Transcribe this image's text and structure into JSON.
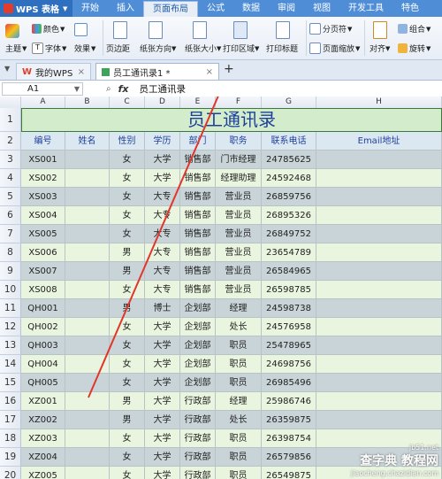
{
  "menubar": {
    "app_title": "WPS 表格",
    "items": [
      "开始",
      "插入",
      "页面布局",
      "公式",
      "数据",
      "审阅",
      "视图",
      "开发工具",
      "特色"
    ],
    "active_index": 2
  },
  "ribbon": {
    "theme": "主题",
    "colors": "颜色",
    "fonts": "字体",
    "effects": "效果",
    "margins": "页边距",
    "orientation": "纸张方向",
    "size": "纸张大小",
    "print_area": "打印区域",
    "print_titles": "打印标题",
    "page_break": "分页符",
    "page_zoom": "页面缩放",
    "align": "对齐",
    "group": "组合",
    "rotate": "旋转"
  },
  "tabs": {
    "tab1_label": "我的WPS",
    "tab2_label": "员工通讯录1 *",
    "add": "+"
  },
  "formula_bar": {
    "cell_ref": "A1",
    "fx": "fx",
    "value": "员工通讯录"
  },
  "sheet": {
    "columns": [
      "A",
      "B",
      "C",
      "D",
      "E",
      "F",
      "G",
      "H"
    ],
    "title": "员工通讯录",
    "headers": [
      "编号",
      "姓名",
      "性别",
      "学历",
      "部门",
      "职务",
      "联系电话",
      "Email地址"
    ],
    "row_numbers": [
      "1",
      "2",
      "3",
      "4",
      "5",
      "6",
      "7",
      "8",
      "9",
      "10",
      "11",
      "12",
      "13",
      "14",
      "15",
      "16",
      "17",
      "18",
      "19",
      "20"
    ],
    "rows": [
      [
        "XS001",
        "",
        "女",
        "大学",
        "销售部",
        "门市经理",
        "24785625",
        ""
      ],
      [
        "XS002",
        "",
        "女",
        "大学",
        "销售部",
        "经理助理",
        "24592468",
        ""
      ],
      [
        "XS003",
        "",
        "女",
        "大专",
        "销售部",
        "营业员",
        "26859756",
        ""
      ],
      [
        "XS004",
        "",
        "女",
        "大专",
        "销售部",
        "营业员",
        "26895326",
        ""
      ],
      [
        "XS005",
        "",
        "女",
        "大专",
        "销售部",
        "营业员",
        "26849752",
        ""
      ],
      [
        "XS006",
        "",
        "男",
        "大专",
        "销售部",
        "营业员",
        "23654789",
        ""
      ],
      [
        "XS007",
        "",
        "男",
        "大专",
        "销售部",
        "营业员",
        "26584965",
        ""
      ],
      [
        "XS008",
        "",
        "女",
        "大专",
        "销售部",
        "营业员",
        "26598785",
        ""
      ],
      [
        "QH001",
        "",
        "男",
        "博士",
        "企划部",
        "经理",
        "24598738",
        ""
      ],
      [
        "QH002",
        "",
        "女",
        "大学",
        "企划部",
        "处长",
        "24576958",
        ""
      ],
      [
        "QH003",
        "",
        "女",
        "大学",
        "企划部",
        "职员",
        "25478965",
        ""
      ],
      [
        "QH004",
        "",
        "女",
        "大学",
        "企划部",
        "职员",
        "24698756",
        ""
      ],
      [
        "QH005",
        "",
        "女",
        "大学",
        "企划部",
        "职员",
        "26985496",
        ""
      ],
      [
        "XZ001",
        "",
        "男",
        "大学",
        "行政部",
        "经理",
        "25986746",
        ""
      ],
      [
        "XZ002",
        "",
        "男",
        "大学",
        "行政部",
        "处长",
        "26359875",
        ""
      ],
      [
        "XZ003",
        "",
        "女",
        "大学",
        "行政部",
        "职员",
        "26398754",
        ""
      ],
      [
        "XZ004",
        "",
        "女",
        "大学",
        "行政部",
        "职员",
        "26579856",
        ""
      ],
      [
        "XZ005",
        "",
        "女",
        "大学",
        "行政部",
        "职员",
        "26549875",
        ""
      ]
    ]
  },
  "watermark": {
    "text": "查字典 教程网",
    "url": "jiaocheng.chazidian.com",
    "tag": "jb51.net"
  },
  "colors": {
    "menubar": "#4f8ed6",
    "title_fill": "#d3eccc",
    "title_text": "#1e3f9a",
    "row_blue": "#c9d4d8",
    "row_green": "#e9f5de",
    "arrow": "#e0362c"
  }
}
